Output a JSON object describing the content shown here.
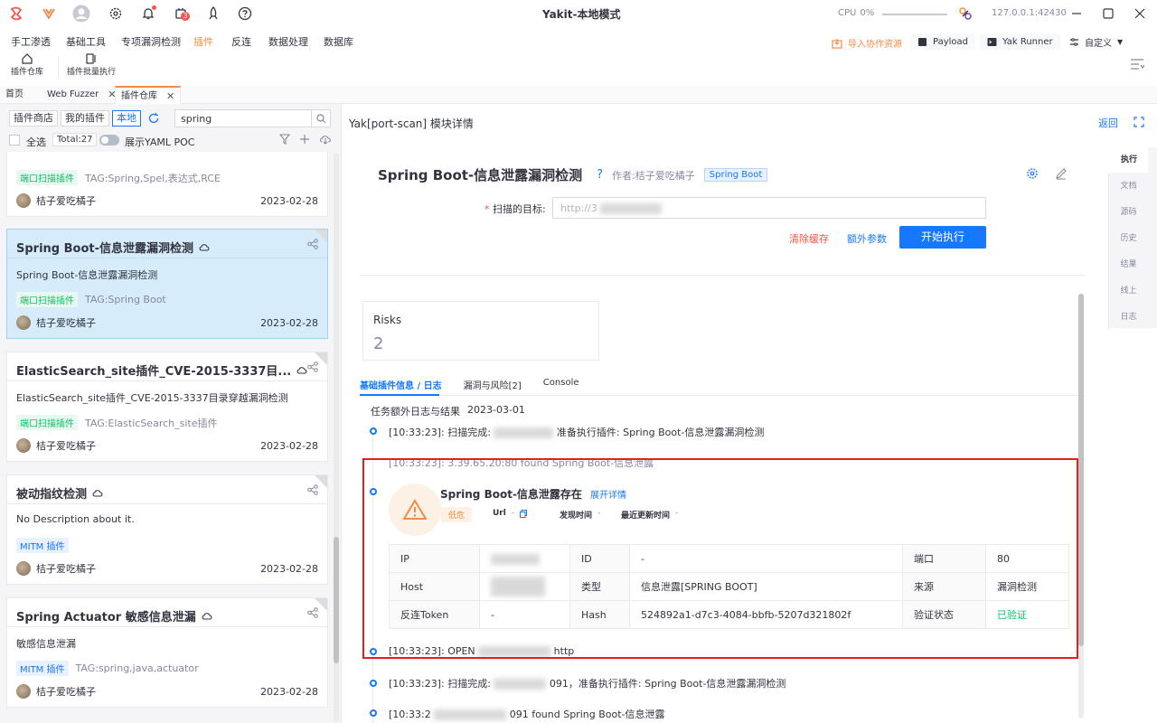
{
  "window": {
    "title": "Yakit-本地模式",
    "cpu_label": "CPU",
    "cpu_value": "0%",
    "ip_port": "127.0.0.1:42430",
    "notif_badge": "3"
  },
  "menu": {
    "items": [
      "手工渗透",
      "基础工具",
      "专项漏洞检测",
      "插件",
      "反连",
      "数据处理",
      "数据库"
    ],
    "active": "插件",
    "import_label": "导入协作资源",
    "payload_label": "Payload",
    "yakrunner_label": "Yak Runner",
    "custom_label": "自定义"
  },
  "subtools": [
    {
      "label": "插件仓库",
      "icon": "home-icon"
    },
    {
      "label": "插件批量执行",
      "icon": "batch-icon"
    }
  ],
  "tabs": [
    {
      "label": "首页",
      "closable": false
    },
    {
      "label": "Web Fuzzer",
      "closable": true
    },
    {
      "label": "插件仓库",
      "closable": true,
      "active": true
    }
  ],
  "left": {
    "segments": [
      "插件商店",
      "我的插件",
      "本地"
    ],
    "active_segment": "本地",
    "search_value": "spring",
    "select_all": "全选",
    "total": "Total:27",
    "yaml_toggle": "展示YAML POC",
    "top_partial": {
      "tagline": "TAG:Spring,Spel,表达式,RCE",
      "tag": "端口扫描插件",
      "author": "桔子爱吃橘子",
      "date": "2023-02-28"
    },
    "cards": [
      {
        "title": "Spring Boot-信息泄露漏洞检测",
        "desc": "Spring Boot-信息泄露漏洞检测",
        "tag": "端口扫描插件",
        "tag_type": "green",
        "tagline": "TAG:Spring Boot",
        "author": "桔子爱吃橘子",
        "date": "2023-02-28",
        "selected": true
      },
      {
        "title": "ElasticSearch_site插件_CVE-2015-3337目...",
        "desc": "ElasticSearch_site插件_CVE-2015-3337目录穿越漏洞检测",
        "tag": "端口扫描插件",
        "tag_type": "green",
        "tagline": "TAG:ElasticSearch_site插件",
        "author": "桔子爱吃橘子",
        "date": "2023-02-28"
      },
      {
        "title": "被动指纹检测",
        "desc": "No Description about it.",
        "tag": "MITM 插件",
        "tag_type": "blue",
        "tagline": "",
        "author": "桔子爱吃橘子",
        "date": "2023-02-28"
      },
      {
        "title": "Spring Actuator 敏感信息泄漏",
        "desc": "敏感信息泄漏",
        "tag": "MITM 插件",
        "tag_type": "blue",
        "tagline": "TAG:spring,java,actuator",
        "author": "桔子爱吃橘子",
        "date": "2023-02-28"
      }
    ]
  },
  "right": {
    "header": "Yak[port-scan] 模块详情",
    "back": "返回",
    "plugin_title": "Spring Boot-信息泄露漏洞检测",
    "author": "作者:桔子爱吃橘子",
    "title_tag": "Spring Boot",
    "target_label": "扫描的目标:",
    "target_value": "http://3",
    "clear_cache": "清除缓存",
    "extra_params": "额外参数",
    "start": "开始执行",
    "risks_label": "Risks",
    "risks_value": "2",
    "result_tabs": [
      "基础插件信息 / 日志",
      "漏洞与风险[2]",
      "Console"
    ],
    "log_header": "任务额外日志与结果",
    "log_date": "2023-03-01",
    "logs": [
      {
        "pre": "[10:33:23]: 扫描完成:",
        "post": "准备执行插件: Spring Boot-信息泄露漏洞检测"
      },
      {
        "pre": "[10:33:23]: 3.39.65.20:80 found Spring Boot-信息泄露",
        "post": ""
      },
      {
        "pre": "[10:33:23]: OPEN",
        "post": "http"
      },
      {
        "pre": "[10:33:23]: 扫描完成:",
        "post": "091，准备执行插件: Spring Boot-信息泄露漏洞检测"
      },
      {
        "pre": "[10:33:2",
        "post": "091 found Spring Boot-信息泄露"
      }
    ],
    "risk_card": {
      "title": "Spring Boot-信息泄露存在",
      "expand": "展开详情",
      "level": "低危",
      "url_label": "Url",
      "url_value": "-",
      "found_label": "发现时间",
      "found_value": "-",
      "updated_label": "最近更新时间",
      "updated_value": "-",
      "rows": [
        [
          "IP",
          "",
          "ID",
          "-",
          "端口",
          "80"
        ],
        [
          "Host",
          "",
          "类型",
          "信息泄露[SPRING BOOT]",
          "来源",
          "漏洞检测"
        ],
        [
          "反连Token",
          "-",
          "Hash",
          "524892a1-d7c3-4084-bbfb-5207d321802f",
          "验证状态",
          "已验证"
        ]
      ]
    },
    "side_tabs": [
      "执行",
      "文档",
      "源码",
      "历史",
      "结果",
      "线上",
      "日志"
    ],
    "active_side_tab": "执行"
  },
  "colors": {
    "accent": "#f28b44",
    "primary": "#1677ff",
    "danger": "#f6544a",
    "success": "#11c16b",
    "highlight_box": "#e02020"
  }
}
